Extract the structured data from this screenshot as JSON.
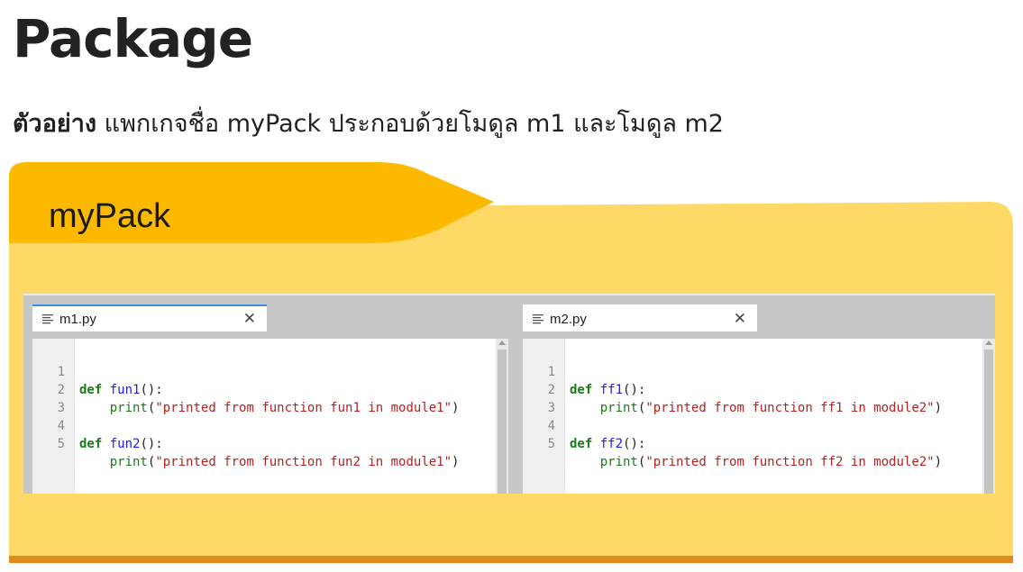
{
  "header": {
    "title": "Package",
    "example_label": "ตัวอย่าง",
    "description": " แพกเกจชื่อ myPack ประกอบด้วยโมดูล m1 และโมดูล m2"
  },
  "folder": {
    "name": "myPack",
    "colors": {
      "tab": "#FDB900",
      "body": "#FFD966",
      "bottom_edge": "#E08A1E"
    }
  },
  "editors": [
    {
      "filename": "m1.py",
      "close_glyph": "✕",
      "lines": [
        {
          "n": "1",
          "text": "def fun1():"
        },
        {
          "n": "2",
          "text": "    print(\"printed from function fun1 in module1\")"
        },
        {
          "n": "3",
          "text": ""
        },
        {
          "n": "4",
          "text": "def fun2():"
        },
        {
          "n": "5",
          "text": "    print(\"printed from function fun2 in module1\")"
        }
      ]
    },
    {
      "filename": "m2.py",
      "close_glyph": "✕",
      "lines": [
        {
          "n": "1",
          "text": "def ff1():"
        },
        {
          "n": "2",
          "text": "    print(\"printed from function ff1 in module2\")"
        },
        {
          "n": "3",
          "text": ""
        },
        {
          "n": "4",
          "text": "def ff2():"
        },
        {
          "n": "5",
          "text": "    print(\"printed from function ff2 in module2\")"
        }
      ]
    }
  ]
}
